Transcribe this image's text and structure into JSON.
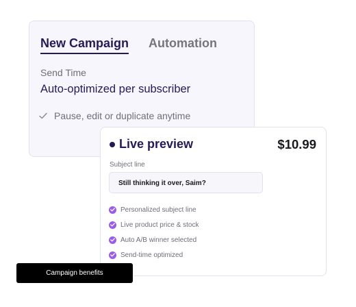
{
  "campaign_card": {
    "tabs": [
      {
        "label": "New Campaign",
        "active": true
      },
      {
        "label": "Automation",
        "active": false
      }
    ],
    "send_time_label": "Send Time",
    "send_time_value": "Auto-optimized per subscriber",
    "feature": "Pause, edit or duplicate anytime"
  },
  "preview_card": {
    "title": "Live preview",
    "price": "$10.99",
    "subject_label": "Subject line",
    "subject_value": "Still thinking it over, Saim?",
    "features": [
      "Personalized subject line",
      "Live product price & stock",
      "Auto A/B winner selected",
      "Send-time optimized"
    ]
  },
  "tooltip": {
    "label": "Campaign benefits"
  },
  "colors": {
    "accent": "#241a57",
    "check": "#9b5de5",
    "muted_text": "#6f6e78",
    "card_bg": "#f7f6fd"
  }
}
